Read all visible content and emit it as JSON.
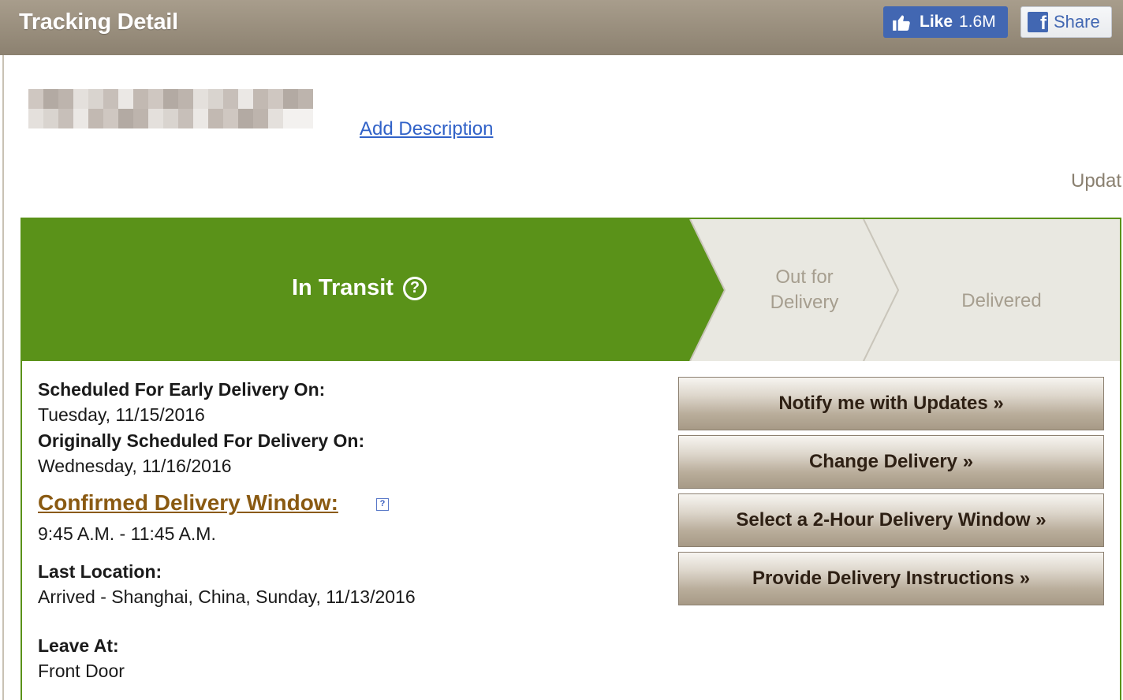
{
  "header": {
    "title": "Tracking Detail",
    "like_label": "Like",
    "like_count": "1.6M",
    "share_label": "Share"
  },
  "description": {
    "add_link": "Add Description",
    "updated_partial": "Updat"
  },
  "progress": {
    "steps": [
      {
        "label": "In Transit",
        "active": true
      },
      {
        "label_line1": "Out for",
        "label_line2": "Delivery",
        "active": false
      },
      {
        "label": "Delivered",
        "active": false
      }
    ],
    "active_color": "#5a9219",
    "inactive_color": "#e9e8e1"
  },
  "details": {
    "early_label": "Scheduled For Early Delivery On:",
    "early_value": "Tuesday, 11/15/2016",
    "orig_label": "Originally Scheduled For Delivery On:",
    "orig_value": "Wednesday, 11/16/2016",
    "window_link": "Confirmed Delivery Window:",
    "window_value": "9:45 A.M. - 11:45 A.M.",
    "location_label": "Last Location:",
    "location_value": "Arrived - Shanghai, China, Sunday, 11/13/2016",
    "leave_label": "Leave At:",
    "leave_value": "Front Door"
  },
  "actions": {
    "notify": "Notify me with Updates »",
    "change": "Change Delivery »",
    "window": "Select a 2-Hour Delivery Window »",
    "instructions": "Provide Delivery Instructions »"
  }
}
